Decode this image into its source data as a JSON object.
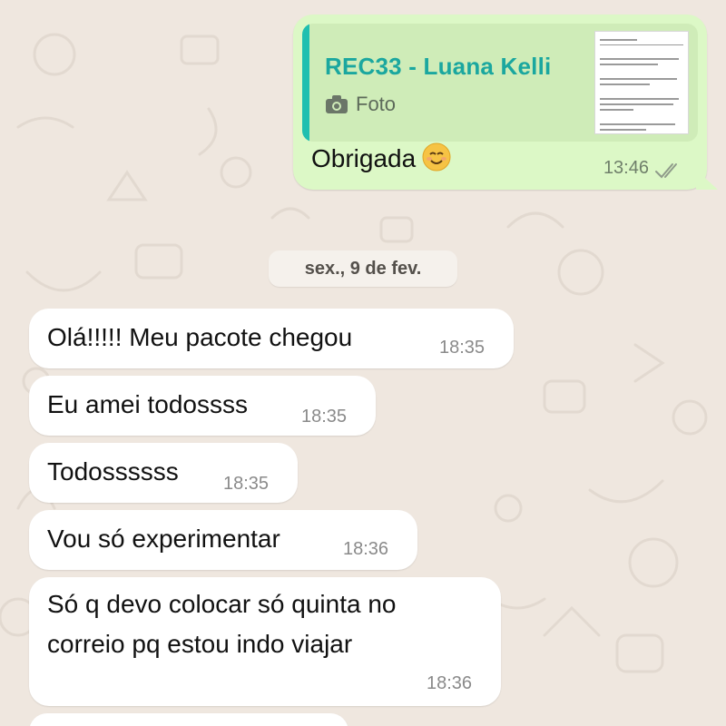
{
  "outgoing": {
    "quote_title": "REC33 - Luana Kelli",
    "quote_type": "Foto",
    "text": "Obrigada",
    "emoji": "smiling-face-icon",
    "time": "13:46",
    "status": "read-check-icon"
  },
  "date_separator": "sex., 9 de fev.",
  "incoming": [
    {
      "text": "Olá!!!!! Meu pacote chegou",
      "time": "18:35"
    },
    {
      "text": "Eu amei todossss",
      "time": "18:35"
    },
    {
      "text": "Todossssss",
      "time": "18:35"
    },
    {
      "text": "Vou só experimentar",
      "time": "18:36"
    },
    {
      "line1": "Só q devo colocar só quinta no",
      "line2": "correio pq estou indo viajar",
      "time": "18:36"
    }
  ],
  "colors": {
    "background": "#efe7df",
    "outgoing_bubble": "#dcf8c6",
    "incoming_bubble": "#ffffff",
    "quote_accent": "#1fbfb0"
  }
}
